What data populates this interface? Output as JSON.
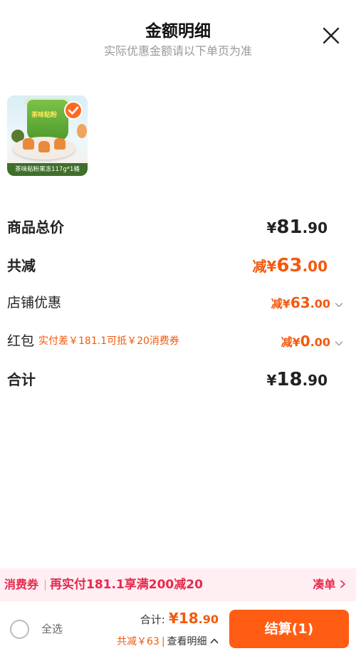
{
  "header": {
    "title": "金额明细",
    "subtitle": "实际优惠金额请以下单页为准"
  },
  "product": {
    "label": "茶味粘粉果冻117g*1桶",
    "cup_text": "茶味粘粉"
  },
  "summary": {
    "goods_total_label": "商品总价",
    "goods_total_currency": "¥",
    "goods_total_int": "81",
    "goods_total_dec": ".90",
    "discount_label": "共减",
    "discount_prefix": "减¥",
    "discount_int": "63",
    "discount_dec": ".00",
    "store_label": "店铺优惠",
    "store_prefix": "减¥",
    "store_int": "63",
    "store_dec": ".00",
    "redpacket_label": "红包",
    "redpacket_note": "实付差￥181.1可抵￥20消费券",
    "redpacket_prefix": "减¥",
    "redpacket_int": "0",
    "redpacket_dec": ".00",
    "total_label": "合计",
    "total_currency": "¥",
    "total_int": "18",
    "total_dec": ".90"
  },
  "banner": {
    "tag": "消费券",
    "text": "再实付181.1享满200减20",
    "link": "凑单"
  },
  "footer": {
    "select_all": "全选",
    "total_label": "合计:",
    "total_currency": "¥",
    "total_int": "18",
    "total_dec": ".90",
    "saving_prefix": "共减",
    "saving_amount": "￥63",
    "saving_sep": "|",
    "view_detail": "查看明细",
    "checkout": "结算(1)"
  },
  "colors": {
    "accent": "#ff5c14",
    "discount": "#f25a0e",
    "coupon": "#e62a4e",
    "banner_bg": "#ffeef2"
  }
}
